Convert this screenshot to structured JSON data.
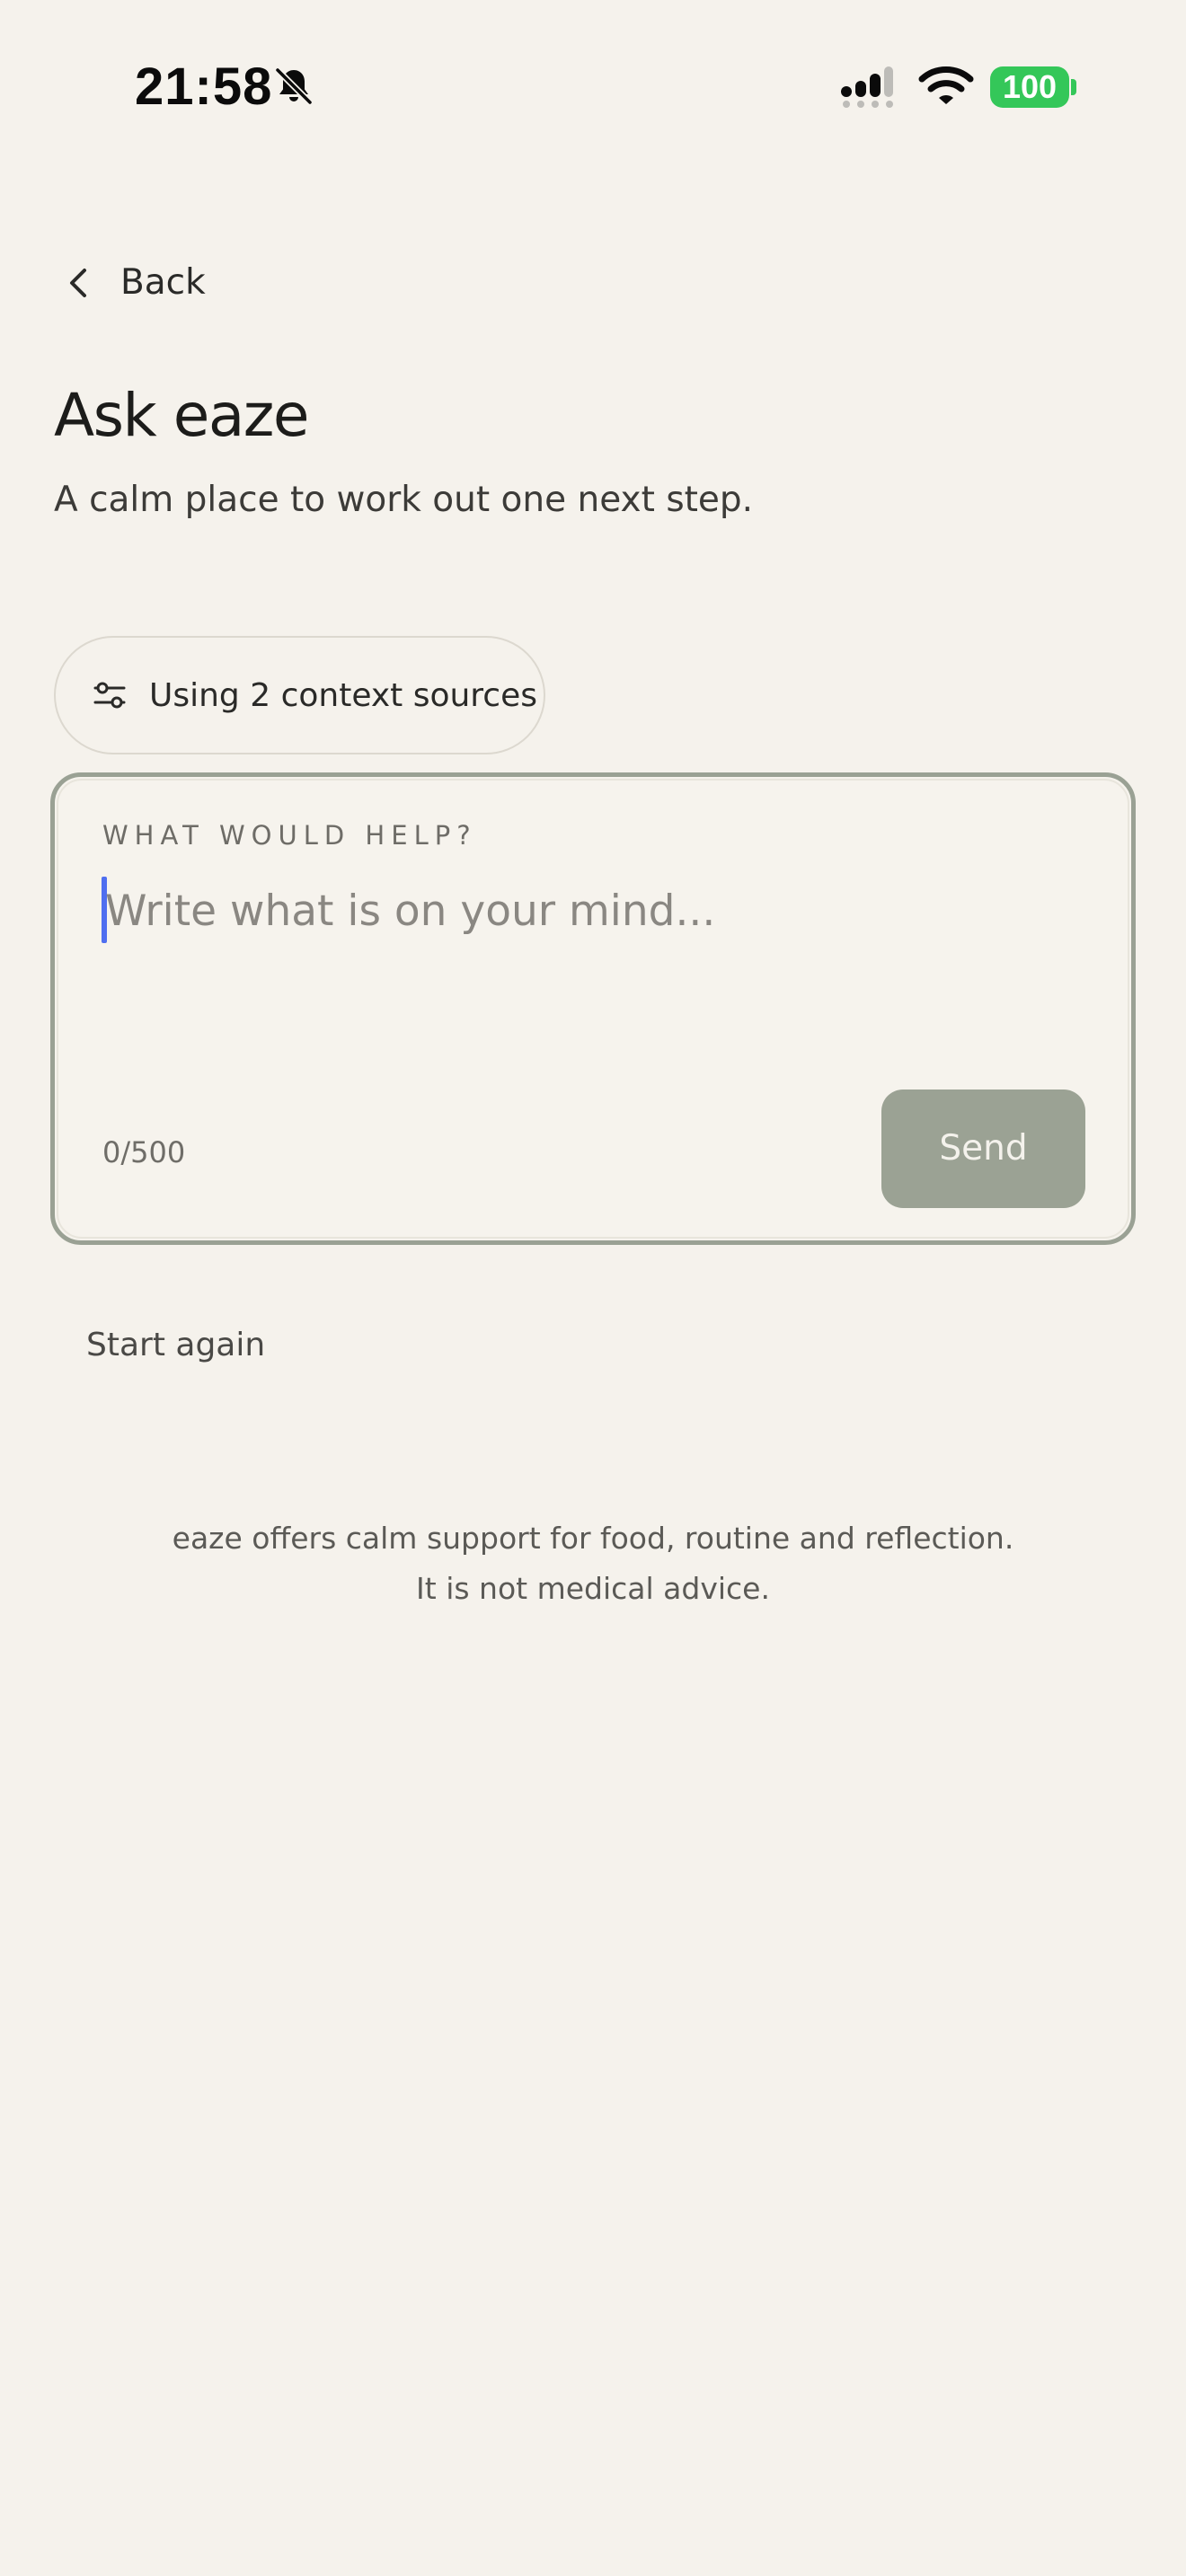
{
  "status_bar": {
    "time": "21:58",
    "battery": "100",
    "icons": [
      "bell-slash-icon",
      "signal-icon",
      "wifi-icon",
      "battery-icon"
    ]
  },
  "nav": {
    "back_label": "Back",
    "icon": "chevron-left-icon"
  },
  "header": {
    "title": "Ask eaze",
    "subtitle": "A calm place to work out one next step."
  },
  "context_chip": {
    "label": "Using 2 context sources",
    "icon": "sliders-icon"
  },
  "composer": {
    "eyebrow": "WHAT WOULD HELP?",
    "placeholder": "Write what is on your mind...",
    "char_count": "0/500",
    "send_label": "Send"
  },
  "actions": {
    "start_again_label": "Start again"
  },
  "disclaimer": {
    "line1": "eaze offers calm support for food, routine and reflection.",
    "line2": "It is not medical advice."
  },
  "colors": {
    "background": "#f5f2ec",
    "accent": "#9ba294",
    "caret": "#4f6ef0",
    "battery": "#34c759"
  }
}
